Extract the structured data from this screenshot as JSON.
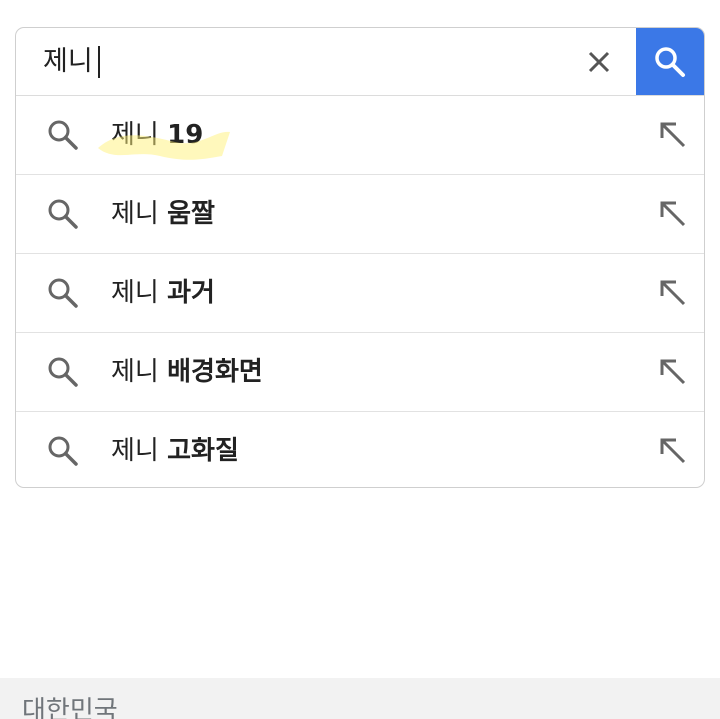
{
  "search": {
    "query": "제니",
    "clear_icon": "close-icon",
    "submit_icon": "search-icon",
    "accent_color": "#3b78e7"
  },
  "suggestions": [
    {
      "typed": "제니",
      "rest": "19"
    },
    {
      "typed": "제니",
      "rest": "움짤"
    },
    {
      "typed": "제니",
      "rest": "과거"
    },
    {
      "typed": "제니",
      "rest": "배경화면"
    },
    {
      "typed": "제니",
      "rest": "고화질"
    }
  ],
  "footer": {
    "region": "대한민국"
  }
}
